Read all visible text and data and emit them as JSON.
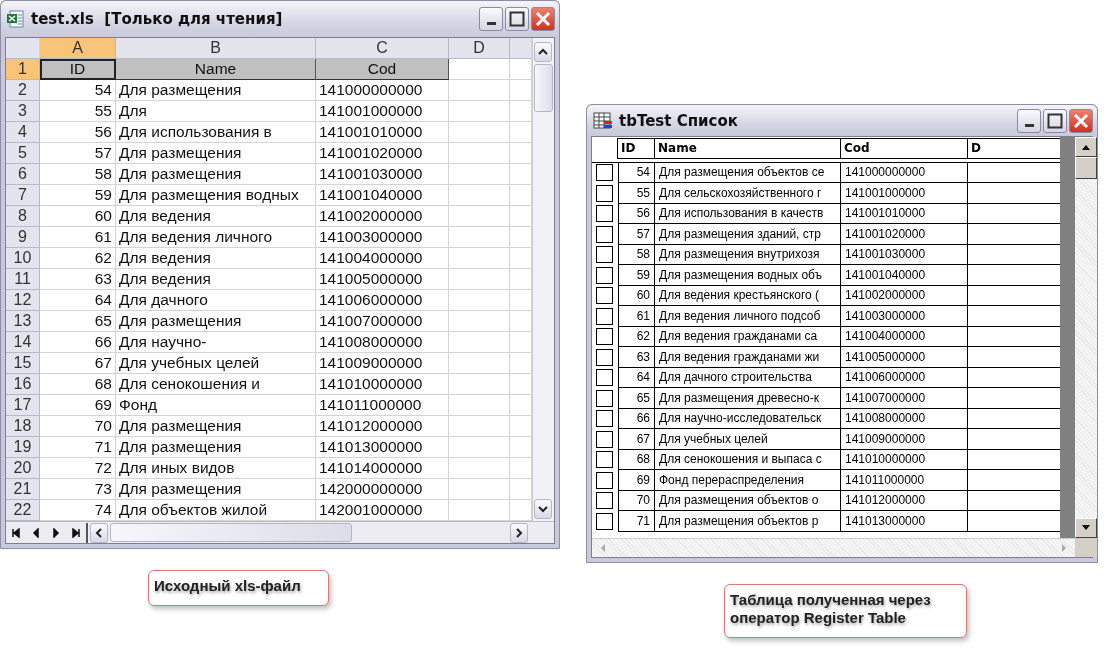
{
  "spreadsheet_window": {
    "title": "test.xls",
    "title_suffix": "[Только для чтения]",
    "columns": [
      {
        "label": "A",
        "selected": true
      },
      {
        "label": "B",
        "selected": false
      },
      {
        "label": "C",
        "selected": false
      },
      {
        "label": "D",
        "selected": false
      }
    ],
    "rows": [
      {
        "number": "1",
        "selected": true,
        "kind": "header",
        "cells": [
          "ID",
          "Name",
          "Cod"
        ]
      },
      {
        "number": "2",
        "selected": false,
        "kind": "data",
        "cells": [
          "54",
          "Для размещения",
          "141000000000"
        ]
      },
      {
        "number": "3",
        "selected": false,
        "kind": "data",
        "cells": [
          "55",
          "Для",
          "141001000000"
        ]
      },
      {
        "number": "4",
        "selected": false,
        "kind": "data",
        "cells": [
          "56",
          "Для использования в",
          "141001010000"
        ]
      },
      {
        "number": "5",
        "selected": false,
        "kind": "data",
        "cells": [
          "57",
          "Для размещения",
          "141001020000"
        ]
      },
      {
        "number": "6",
        "selected": false,
        "kind": "data",
        "cells": [
          "58",
          "Для размещения",
          "141001030000"
        ]
      },
      {
        "number": "7",
        "selected": false,
        "kind": "data",
        "cells": [
          "59",
          "Для размещения водных",
          "141001040000"
        ]
      },
      {
        "number": "8",
        "selected": false,
        "kind": "data",
        "cells": [
          "60",
          "Для ведения",
          "141002000000"
        ]
      },
      {
        "number": "9",
        "selected": false,
        "kind": "data",
        "cells": [
          "61",
          "Для ведения личного",
          "141003000000"
        ]
      },
      {
        "number": "10",
        "selected": false,
        "kind": "data",
        "cells": [
          "62",
          "Для ведения",
          "141004000000"
        ]
      },
      {
        "number": "11",
        "selected": false,
        "kind": "data",
        "cells": [
          "63",
          "Для ведения",
          "141005000000"
        ]
      },
      {
        "number": "12",
        "selected": false,
        "kind": "data",
        "cells": [
          "64",
          "Для дачного",
          "141006000000"
        ]
      },
      {
        "number": "13",
        "selected": false,
        "kind": "data",
        "cells": [
          "65",
          "Для размещения",
          "141007000000"
        ]
      },
      {
        "number": "14",
        "selected": false,
        "kind": "data",
        "cells": [
          "66",
          "Для научно-",
          "141008000000"
        ]
      },
      {
        "number": "15",
        "selected": false,
        "kind": "data",
        "cells": [
          "67",
          "Для учебных целей",
          "141009000000"
        ]
      },
      {
        "number": "16",
        "selected": false,
        "kind": "data",
        "cells": [
          "68",
          "Для сенокошения и",
          "141010000000"
        ]
      },
      {
        "number": "17",
        "selected": false,
        "kind": "data",
        "cells": [
          "69",
          "Фонд",
          "141011000000"
        ]
      },
      {
        "number": "18",
        "selected": false,
        "kind": "data",
        "cells": [
          "70",
          "Для размещения",
          "141012000000"
        ]
      },
      {
        "number": "19",
        "selected": false,
        "kind": "data",
        "cells": [
          "71",
          "Для размещения",
          "141013000000"
        ]
      },
      {
        "number": "20",
        "selected": false,
        "kind": "data",
        "cells": [
          "72",
          "Для иных видов",
          "141014000000"
        ]
      },
      {
        "number": "21",
        "selected": false,
        "kind": "data",
        "cells": [
          "73",
          "Для размещения",
          "142000000000"
        ]
      },
      {
        "number": "22",
        "selected": false,
        "kind": "data",
        "cells": [
          "74",
          "Для объектов жилой",
          "142001000000"
        ]
      }
    ]
  },
  "browse_window": {
    "title": "tbTest Список",
    "columns": [
      "ID",
      "Name",
      "Cod",
      "D"
    ],
    "rows": [
      {
        "checked": false,
        "cells": [
          "54",
          "Для размещения объектов се",
          "141000000000"
        ]
      },
      {
        "checked": false,
        "cells": [
          "55",
          "Для сельскохозяйственного г",
          "141001000000"
        ]
      },
      {
        "checked": false,
        "cells": [
          "56",
          "Для использования в качеств",
          "141001010000"
        ]
      },
      {
        "checked": false,
        "cells": [
          "57",
          "Для размещения зданий, стр",
          "141001020000"
        ]
      },
      {
        "checked": false,
        "cells": [
          "58",
          "Для размещения внутрихозя",
          "141001030000"
        ]
      },
      {
        "checked": false,
        "cells": [
          "59",
          "Для размещения водных объ",
          "141001040000"
        ]
      },
      {
        "checked": false,
        "cells": [
          "60",
          "Для ведения крестьянского (",
          "141002000000"
        ]
      },
      {
        "checked": false,
        "cells": [
          "61",
          "Для ведения личного подсоб",
          "141003000000"
        ]
      },
      {
        "checked": false,
        "cells": [
          "62",
          "Для ведения гражданами са",
          "141004000000"
        ]
      },
      {
        "checked": false,
        "cells": [
          "63",
          "Для ведения гражданами жи",
          "141005000000"
        ]
      },
      {
        "checked": false,
        "cells": [
          "64",
          "Для дачного строительства",
          "141006000000"
        ]
      },
      {
        "checked": false,
        "cells": [
          "65",
          "Для размещения древесно-к",
          "141007000000"
        ]
      },
      {
        "checked": false,
        "cells": [
          "66",
          "Для научно-исследовательск",
          "141008000000"
        ]
      },
      {
        "checked": false,
        "cells": [
          "67",
          "Для учебных целей",
          "141009000000"
        ]
      },
      {
        "checked": false,
        "cells": [
          "68",
          "Для сенокошения и выпаса с",
          "141010000000"
        ]
      },
      {
        "checked": false,
        "cells": [
          "69",
          "Фонд перераспределения",
          "141011000000"
        ]
      },
      {
        "checked": false,
        "cells": [
          "70",
          "Для размещения объектов о",
          "141012000000"
        ]
      },
      {
        "checked": false,
        "cells": [
          "71",
          "Для размещения объектов р",
          "141013000000"
        ]
      }
    ]
  },
  "captions": [
    "Исходный xls-файл",
    "Таблица полученная через оператор Register Table"
  ]
}
